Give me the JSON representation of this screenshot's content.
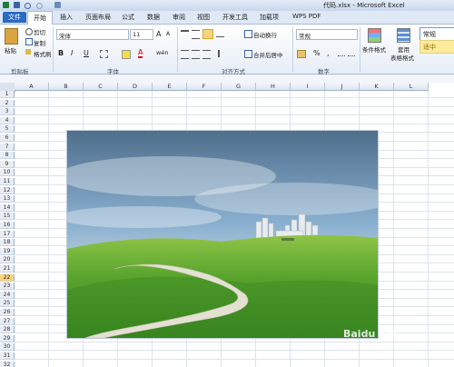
{
  "window": {
    "title": "代码.xlsx - Microsoft Excel"
  },
  "tabs": [
    "文件",
    "开始",
    "插入",
    "页面布局",
    "公式",
    "数据",
    "审阅",
    "视图",
    "开发工具",
    "加载项",
    "WPS PDF"
  ],
  "clipboard": {
    "paste_label": "粘贴",
    "cut_label": "剪切",
    "copy_label": "复制",
    "format_painter_label": "格式刷",
    "group_label": "剪贴板"
  },
  "font": {
    "name": "宋体",
    "size": "11",
    "bold": "B",
    "italic": "I",
    "underline": "U",
    "grow": "A",
    "shrink": "A",
    "color_glyph": "A",
    "phonetic": "wén",
    "group_label": "字体"
  },
  "alignment": {
    "wrap_label": "自动换行",
    "merge_label": "合并后居中",
    "group_label": "对齐方式"
  },
  "number": {
    "format": "常规",
    "percent": "%",
    "comma": ",",
    "group_label": "数字"
  },
  "styles": {
    "conditional_label": "条件格式",
    "table_label": "套用",
    "table_label2": "表格格式",
    "style_normal": "常规",
    "style_neutral": "适中"
  },
  "columns": [
    "A",
    "B",
    "C",
    "D",
    "E",
    "F",
    "G",
    "H",
    "I",
    "J",
    "K",
    "L"
  ],
  "rows": [
    "1",
    "2",
    "3",
    "4",
    "5",
    "6",
    "7",
    "8",
    "9",
    "10",
    "11",
    "12",
    "13",
    "14",
    "15",
    "16",
    "17",
    "18",
    "19",
    "20",
    "21",
    "22",
    "23",
    "24",
    "25",
    "26",
    "27",
    "28",
    "29",
    "30",
    "31",
    "32"
  ],
  "selected_row": "22",
  "colors": {
    "file_tab": "#2a6ac1",
    "selected_row": "#f7d37c",
    "neutral_style": "#ffeb9c",
    "grass": "#4f9a2a",
    "sky": "#8ab0d0"
  },
  "watermark": "Baidu 经验"
}
